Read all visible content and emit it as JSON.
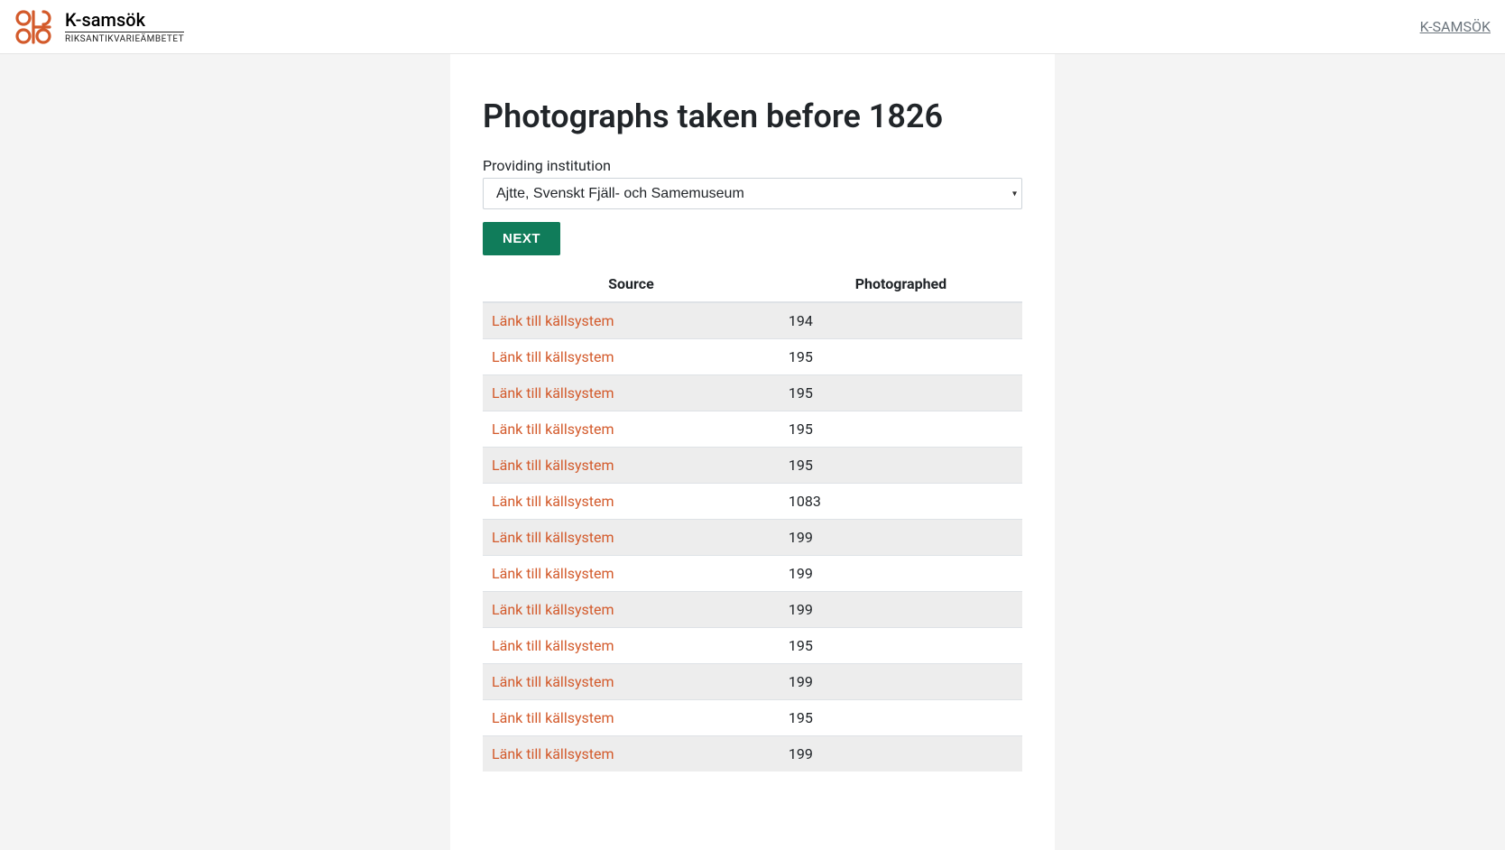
{
  "header": {
    "logo_title": "K-samsök",
    "logo_sub": "RIKSANTIKVARIEÄMBETET",
    "right_link": "K-SAMSÖK"
  },
  "main": {
    "title": "Photographs taken before 1826",
    "field_label": "Providing institution",
    "select_value": "Ajtte, Svenskt Fjäll- och Samemuseum",
    "next_label": "NEXT",
    "columns": {
      "source": "Source",
      "photographed": "Photographed"
    },
    "link_text": "Länk till källsystem",
    "rows": [
      {
        "photographed": "194"
      },
      {
        "photographed": "195"
      },
      {
        "photographed": "195"
      },
      {
        "photographed": "195"
      },
      {
        "photographed": "195"
      },
      {
        "photographed": "1083"
      },
      {
        "photographed": "199"
      },
      {
        "photographed": "199"
      },
      {
        "photographed": "199"
      },
      {
        "photographed": "195"
      },
      {
        "photographed": "199"
      },
      {
        "photographed": "195"
      },
      {
        "photographed": "199"
      }
    ]
  }
}
